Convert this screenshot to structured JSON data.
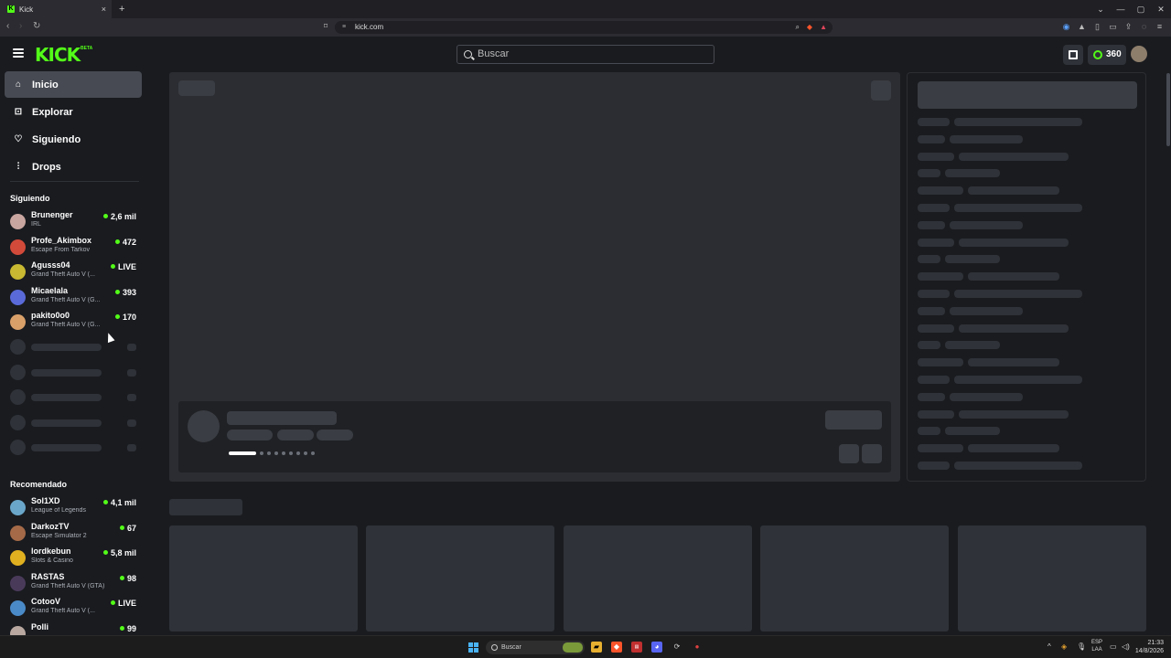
{
  "browser": {
    "tab_title": "Kick",
    "tab_close": "×",
    "new_tab": "+",
    "url": "kick.com",
    "window_controls": [
      "⌄",
      "—",
      "▢",
      "✕"
    ]
  },
  "header": {
    "logo": "KICK",
    "logo_badge": "BETA",
    "search_placeholder": "Buscar",
    "coins": "360"
  },
  "sidebar": {
    "nav": [
      {
        "label": "Inicio",
        "icon": "home-icon",
        "active": true
      },
      {
        "label": "Explorar",
        "icon": "compass-icon",
        "active": false
      },
      {
        "label": "Siguiendo",
        "icon": "heart-icon",
        "active": false
      },
      {
        "label": "Drops",
        "icon": "drops-icon",
        "active": false
      }
    ],
    "following_title": "Siguiendo",
    "following": [
      {
        "name": "Brunenger",
        "category": "IRL",
        "viewers": "2,6 mil",
        "color": "#c9a6a0"
      },
      {
        "name": "Profe_Akimbox",
        "category": "Escape From Tarkov",
        "viewers": "472",
        "color": "#d24a3a"
      },
      {
        "name": "Agusss04",
        "category": "Grand Theft Auto V (...",
        "viewers": "LIVE",
        "color": "#c8b832"
      },
      {
        "name": "Micaelala",
        "category": "Grand Theft Auto V (G...",
        "viewers": "393",
        "color": "#5a6ad8"
      },
      {
        "name": "pakito0o0",
        "category": "Grand Theft Auto V (G...",
        "viewers": "170",
        "color": "#d9a06a"
      }
    ],
    "recommended_title": "Recomendado",
    "recommended": [
      {
        "name": "Sol1XD",
        "category": "League of Legends",
        "viewers": "4,1 mil",
        "color": "#6aa6c9"
      },
      {
        "name": "DarkozTV",
        "category": "Escape Simulator 2",
        "viewers": "67",
        "color": "#a56a48"
      },
      {
        "name": "lordkebun",
        "category": "Slots & Casino",
        "viewers": "5,8 mil",
        "color": "#e0b020"
      },
      {
        "name": "RASTAS",
        "category": "Grand Theft Auto V (GTA)",
        "viewers": "98",
        "color": "#4a3a5a"
      },
      {
        "name": "CotooV",
        "category": "Grand Theft Auto V (...",
        "viewers": "LIVE",
        "color": "#4a8ac8"
      },
      {
        "name": "Polli",
        "category": "",
        "viewers": "99",
        "color": "#b8a8a0"
      }
    ]
  },
  "taskbar": {
    "search_placeholder": "Buscar",
    "lang_top": "ESP",
    "lang_bottom": "LAA",
    "time": "21:33",
    "date": "14/8/2026"
  }
}
